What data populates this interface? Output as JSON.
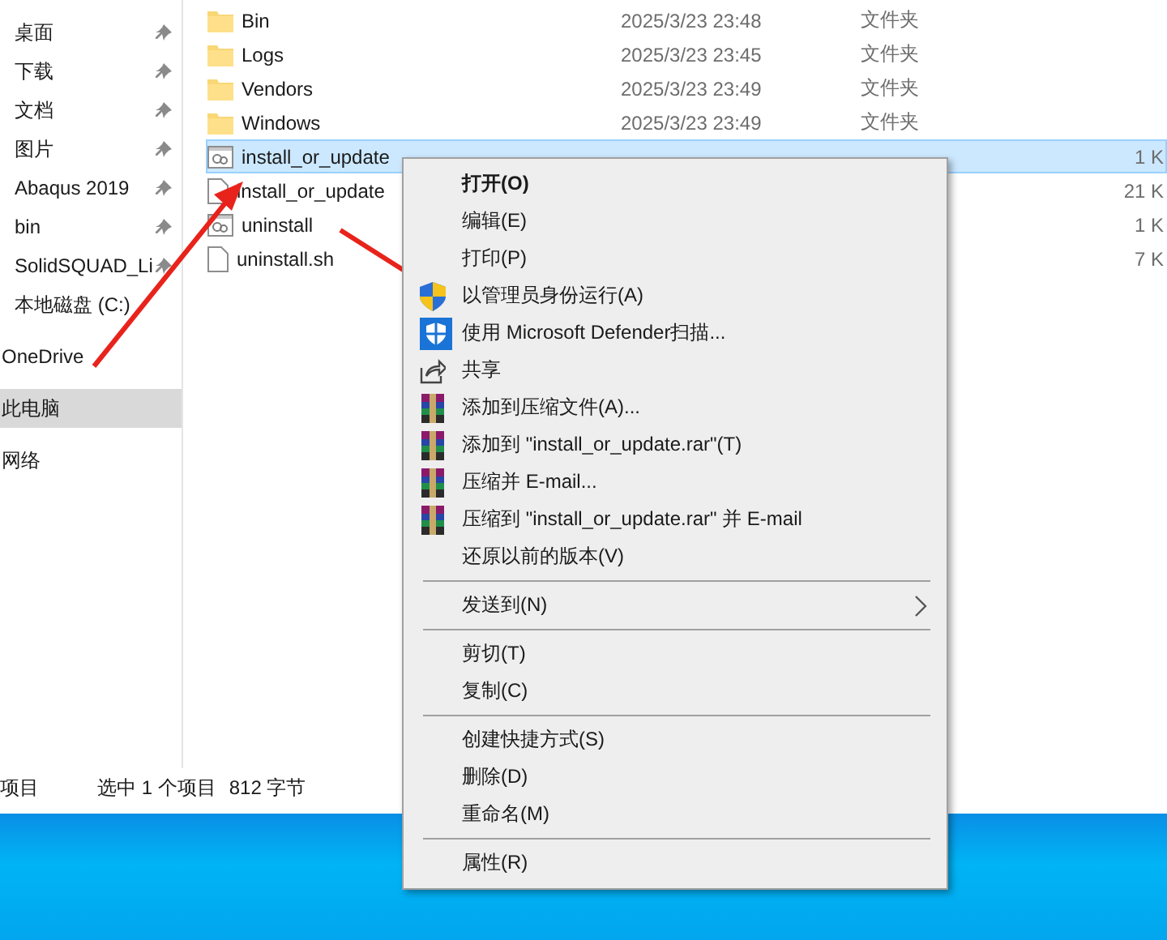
{
  "sidebar": {
    "groups": [
      {
        "items": [
          {
            "label": "桌面",
            "pinned": true,
            "selected": false
          },
          {
            "label": "下载",
            "pinned": true,
            "selected": false
          },
          {
            "label": "文档",
            "pinned": true,
            "selected": false
          },
          {
            "label": "图片",
            "pinned": true,
            "selected": false
          },
          {
            "label": "Abaqus 2019",
            "pinned": true,
            "selected": false
          },
          {
            "label": "bin",
            "pinned": true,
            "selected": false
          },
          {
            "label": "SolidSQUAD_Li",
            "pinned": true,
            "selected": false
          },
          {
            "label": "本地磁盘 (C:)",
            "pinned": false,
            "selected": false
          }
        ]
      },
      {
        "items": [
          {
            "label": "OneDrive",
            "pinned": false,
            "selected": false
          }
        ]
      },
      {
        "items": [
          {
            "label": "此电脑",
            "pinned": false,
            "selected": true
          }
        ]
      },
      {
        "items": [
          {
            "label": "网络",
            "pinned": false,
            "selected": false
          }
        ]
      }
    ]
  },
  "files": [
    {
      "kind": "folder",
      "name": "Bin",
      "date": "2025/3/23 23:48",
      "type": "文件夹",
      "selected": false
    },
    {
      "kind": "folder",
      "name": "Logs",
      "date": "2025/3/23 23:45",
      "type": "文件夹",
      "selected": false
    },
    {
      "kind": "folder",
      "name": "Vendors",
      "date": "2025/3/23 23:49",
      "type": "文件夹",
      "selected": false
    },
    {
      "kind": "folder",
      "name": "Windows",
      "date": "2025/3/23 23:49",
      "type": "文件夹",
      "selected": false
    },
    {
      "kind": "batch",
      "name": "install_or_update",
      "size": "1 K",
      "selected": true
    },
    {
      "kind": "document",
      "name": "install_or_update",
      "size": "21 K",
      "selected": false
    },
    {
      "kind": "batch",
      "name": "uninstall",
      "size": "1 K",
      "selected": false
    },
    {
      "kind": "document",
      "name": "uninstall.sh",
      "size": "7 K",
      "selected": false
    }
  ],
  "status_bar": [
    "项目",
    "选中 1 个项目",
    "812 字节"
  ],
  "context_menu": [
    {
      "kind": "default",
      "label": "打开(O)"
    },
    {
      "kind": "plain",
      "label": "编辑(E)"
    },
    {
      "kind": "plain",
      "label": "打印(P)"
    },
    {
      "kind": "uac",
      "label": "以管理员身份运行(A)"
    },
    {
      "kind": "defender",
      "label": "使用 Microsoft Defender扫描..."
    },
    {
      "kind": "share",
      "label": "共享"
    },
    {
      "kind": "archive",
      "label": "添加到压缩文件(A)..."
    },
    {
      "kind": "archive",
      "label": "添加到 \"install_or_update.rar\"(T)"
    },
    {
      "kind": "archive",
      "label": "压缩并 E-mail..."
    },
    {
      "kind": "archive",
      "label": "压缩到 \"install_or_update.rar\" 并 E-mail"
    },
    {
      "kind": "plain",
      "label": "还原以前的版本(V)"
    },
    {
      "kind": "separator"
    },
    {
      "kind": "submenu",
      "label": "发送到(N)"
    },
    {
      "kind": "separator"
    },
    {
      "kind": "plain",
      "label": "剪切(T)"
    },
    {
      "kind": "plain",
      "label": "复制(C)"
    },
    {
      "kind": "separator"
    },
    {
      "kind": "plain",
      "label": "创建快捷方式(S)"
    },
    {
      "kind": "plain",
      "label": "删除(D)"
    },
    {
      "kind": "plain",
      "label": "重命名(M)"
    },
    {
      "kind": "separator"
    },
    {
      "kind": "plain",
      "label": "属性(R)"
    }
  ]
}
